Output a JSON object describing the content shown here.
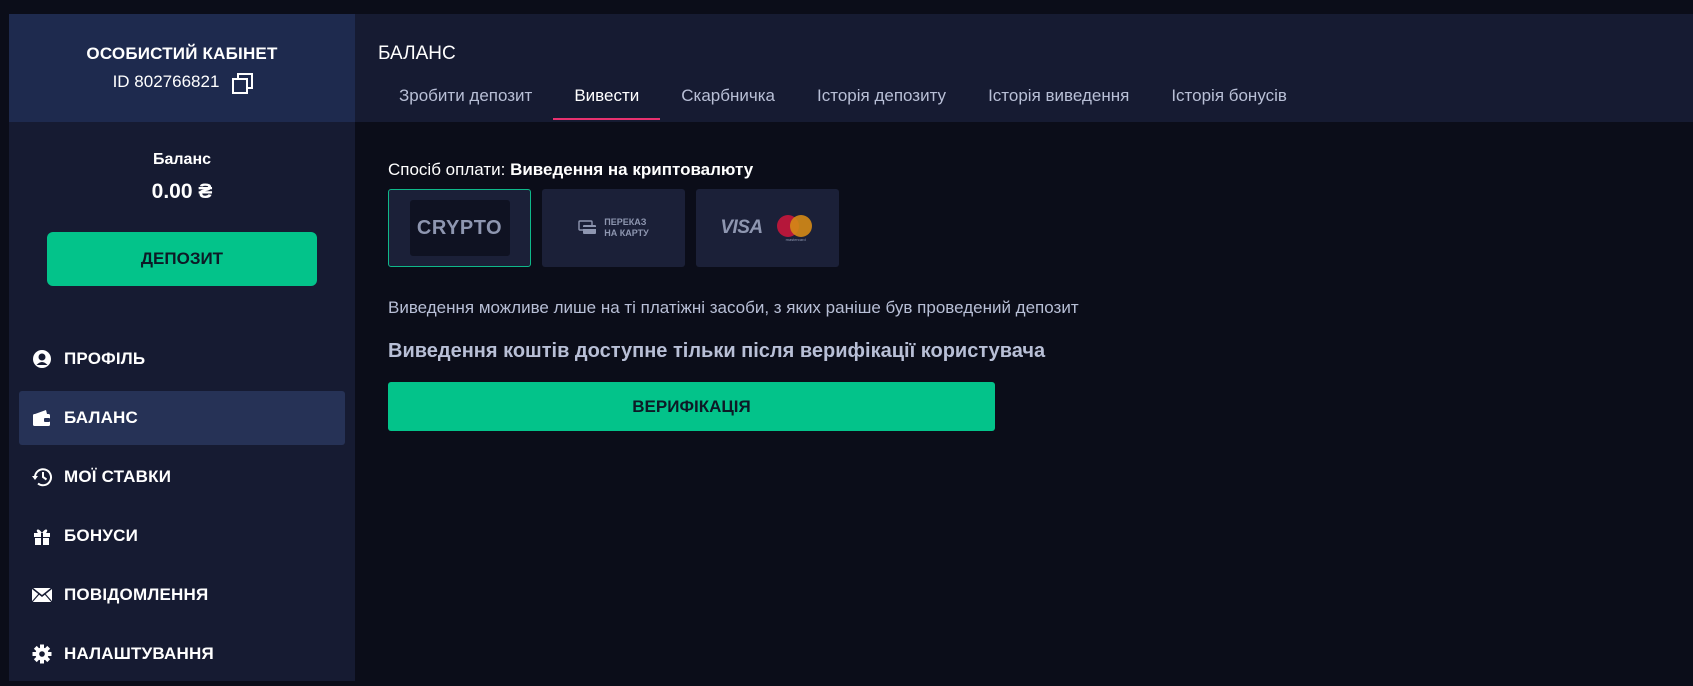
{
  "sidebar": {
    "cabinet_title": "ОСОБИСТИЙ КАБІНЕТ",
    "user_id": "ID 802766821",
    "balance_label": "Баланс",
    "balance_value": "0.00 ₴",
    "deposit_button": "ДЕПОЗИТ",
    "nav": [
      {
        "label": "ПРОФІЛЬ",
        "icon": "profile-icon",
        "active": false
      },
      {
        "label": "БАЛАНС",
        "icon": "wallet-icon",
        "active": true
      },
      {
        "label": "МОЇ СТАВКИ",
        "icon": "history-icon",
        "active": false
      },
      {
        "label": "БОНУСИ",
        "icon": "gift-icon",
        "active": false
      },
      {
        "label": "ПОВІДОМЛЕННЯ",
        "icon": "envelope-icon",
        "active": false
      },
      {
        "label": "НАЛАШТУВАННЯ",
        "icon": "gear-icon",
        "active": false
      }
    ]
  },
  "main": {
    "title": "БАЛАНС",
    "tabs": [
      {
        "label": "Зробити депозит",
        "active": false
      },
      {
        "label": "Вивести",
        "active": true
      },
      {
        "label": "Скарбничка",
        "active": false
      },
      {
        "label": "Історія депозиту",
        "active": false
      },
      {
        "label": "Історія виведення",
        "active": false
      },
      {
        "label": "Історія бонусів",
        "active": false
      }
    ],
    "method_label": "Спосіб оплати:",
    "method_value": "Виведення на криптовалюту",
    "methods": {
      "crypto": "CRYPTO",
      "transfer_line1": "ПЕРЕКАЗ",
      "transfer_line2": "НА КАРТУ",
      "visa": "VISA",
      "mastercard": "mastercard"
    },
    "note": "Виведення можливе лише на ті платіжні засоби, з яких раніше був проведений депозит",
    "warning": "Виведення коштів доступне тільки після верифікації користувача",
    "verify_button": "ВЕРИФІКАЦІЯ"
  },
  "colors": {
    "accent_green": "#03c38a",
    "tab_underline": "#e8316f",
    "sidebar_bg": "#161b32",
    "page_bg": "#0b0d19"
  }
}
